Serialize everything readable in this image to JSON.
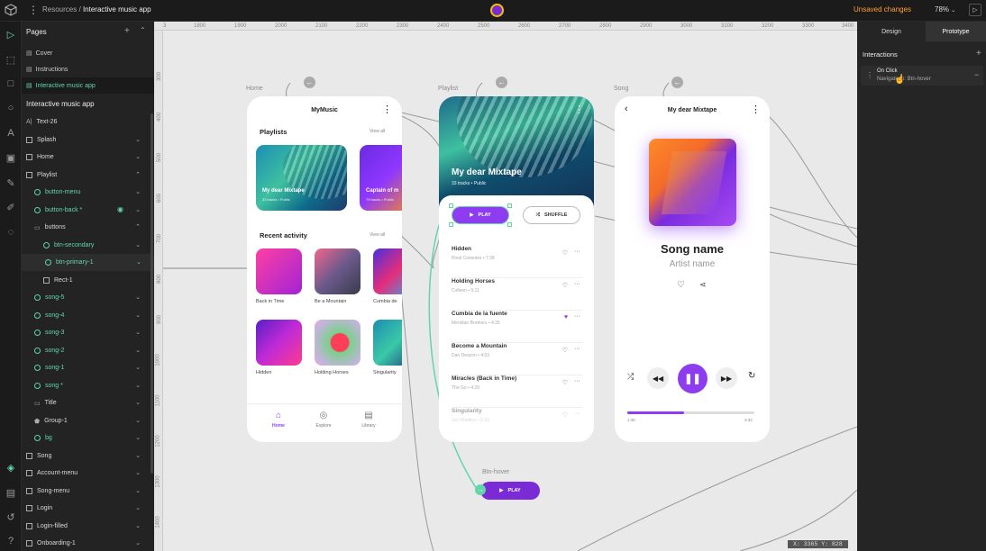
{
  "topbar": {
    "breadcrumb_parent": "Resources",
    "breadcrumb_sep": "/",
    "breadcrumb_current": "Interactive music app",
    "unsaved": "Unsaved changes",
    "zoom": "78%"
  },
  "left": {
    "pages_title": "Pages",
    "pages": [
      "Cover",
      "Instructions",
      "Interactive music app"
    ],
    "layers_title": "Interactive music app",
    "layers": [
      {
        "label": "Text-26",
        "icon": "text"
      },
      {
        "label": "Splash",
        "icon": "frame"
      },
      {
        "label": "Home",
        "icon": "frame"
      },
      {
        "label": "Playlist",
        "icon": "frame"
      },
      {
        "label": "button-menu",
        "icon": "component"
      },
      {
        "label": "button-back *",
        "icon": "component"
      },
      {
        "label": "buttons",
        "icon": "group"
      },
      {
        "label": "btn-secondary",
        "icon": "component"
      },
      {
        "label": "btn-primary-1",
        "icon": "component"
      },
      {
        "label": "Rect-1",
        "icon": "rect"
      },
      {
        "label": "song-5",
        "icon": "component"
      },
      {
        "label": "song-4",
        "icon": "component"
      },
      {
        "label": "song-3",
        "icon": "component"
      },
      {
        "label": "song-2",
        "icon": "component"
      },
      {
        "label": "song-1",
        "icon": "component"
      },
      {
        "label": "song *",
        "icon": "component"
      },
      {
        "label": "Title",
        "icon": "group"
      },
      {
        "label": "Group-1",
        "icon": "shield"
      },
      {
        "label": "bg",
        "icon": "component"
      },
      {
        "label": "Song",
        "icon": "frame"
      },
      {
        "label": "Account-menu",
        "icon": "frame"
      },
      {
        "label": "Song-menu",
        "icon": "frame"
      },
      {
        "label": "Login",
        "icon": "frame"
      },
      {
        "label": "Login-filled",
        "icon": "frame"
      },
      {
        "label": "Onboarding-1",
        "icon": "frame"
      }
    ]
  },
  "ruler": {
    "top": [
      "3",
      "1800",
      "1900",
      "2000",
      "2100",
      "2200",
      "2300",
      "2400",
      "2500",
      "2600",
      "2700",
      "2800",
      "2900",
      "3000",
      "3100",
      "3200",
      "3300",
      "3400"
    ],
    "left": [
      "300",
      "400",
      "500",
      "600",
      "700",
      "800",
      "900",
      "1000",
      "1100",
      "1200",
      "1300",
      "1400"
    ]
  },
  "home": {
    "frame_label": "Home",
    "title": "MyMusic",
    "playlists": "Playlists",
    "view_all_1": "View all",
    "card1_title": "My dear Mixtape",
    "card1_sub": "33 tracks • Public",
    "card2_title": "Captain of m",
    "card2_sub": "79 tracks • Public",
    "recent": "Recent activity",
    "view_all_2": "View all",
    "recent_items": [
      "Back in Time",
      "Be a Mountain",
      "Cumbia de",
      "Hidden",
      "Holding Horses",
      "Singularity"
    ],
    "nav": [
      "Home",
      "Explore",
      "Library"
    ]
  },
  "playlist": {
    "frame_label": "Playlist",
    "title": "My dear Mixtape",
    "sub": "33 tracks • Public",
    "play": "PLAY",
    "shuffle": "SHUFFLE",
    "songs": [
      {
        "title": "Hidden",
        "artist": "Rival Consoles • 7:38"
      },
      {
        "title": "Holding Horses",
        "artist": "Colleen • 5:11"
      },
      {
        "title": "Cumbia de la fuente",
        "artist": "Meridian Brothers • 4:35"
      },
      {
        "title": "Become a Mountain",
        "artist": "Dan Deacon • 4:03"
      },
      {
        "title": "Miracles (Back in Time)",
        "artist": "The Go • 4:29"
      },
      {
        "title": "Singularity",
        "artist": "Jon Hopkins • 6:23"
      }
    ]
  },
  "song": {
    "frame_label": "Song",
    "header": "My dear Mixtape",
    "name": "Song name",
    "artist": "Artist name",
    "time_start": "1:35",
    "time_end": "3:32",
    "progress": 0.45
  },
  "btn_hover": {
    "label": "Btn-hover",
    "play": "PLAY"
  },
  "coords": "X: 3365 Y: 828",
  "right": {
    "tab_design": "Design",
    "tab_prototype": "Prototype",
    "interactions": "Interactions",
    "trigger": "On Click",
    "action": "Navigate to: Btn-hover"
  },
  "colors": {
    "accent": "#9b3ff0",
    "teal": "#62d6a9",
    "unsaved": "#ff9f2e"
  }
}
